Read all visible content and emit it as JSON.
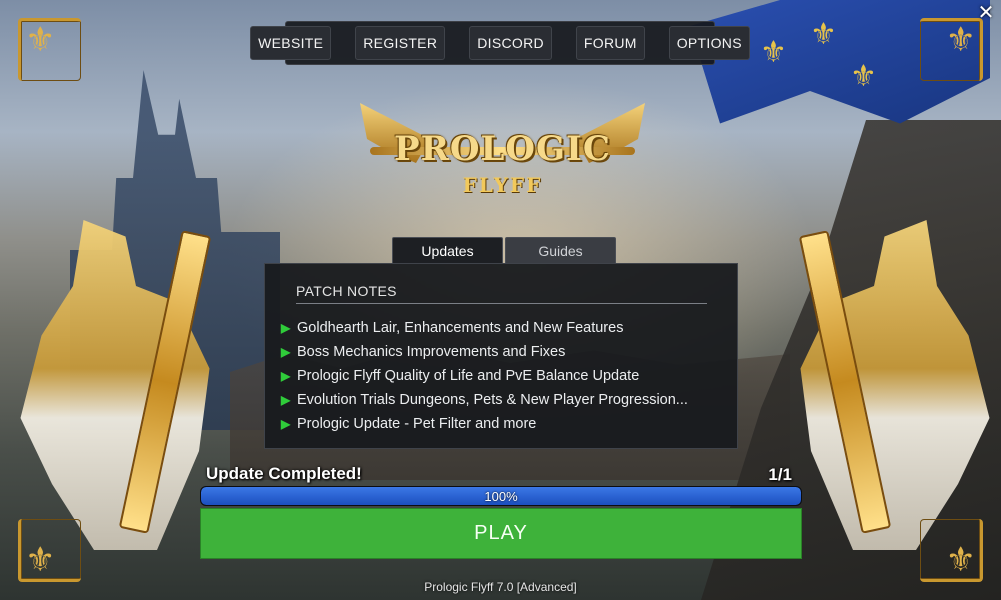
{
  "window": {
    "close_glyph": "✕"
  },
  "nav": {
    "items": [
      {
        "label": "WEBSITE"
      },
      {
        "label": "REGISTER"
      },
      {
        "label": "DISCORD"
      },
      {
        "label": "FORUM"
      },
      {
        "label": "OPTIONS"
      }
    ]
  },
  "logo": {
    "name": "PROLOGIC",
    "sub": "FLYFF"
  },
  "tabs": [
    {
      "label": "Updates",
      "active": true
    },
    {
      "label": "Guides",
      "active": false
    }
  ],
  "patch_notes": {
    "title": "PATCH NOTES",
    "arrow_glyph": "▶",
    "items": [
      "Goldhearth Lair, Enhancements and New Features",
      "Boss Mechanics Improvements and Fixes",
      "Prologic Flyff Quality of Life and PvE Balance Update",
      "Evolution Trials Dungeons, Pets & New Player Progression...",
      "Prologic Update - Pet Filter and more"
    ]
  },
  "status": {
    "text": "Update Completed!",
    "count": "1/1",
    "progress_label": "100%",
    "progress_fraction": 1.0
  },
  "play": {
    "label": "PLAY"
  },
  "footer": {
    "version": "Prologic Flyff 7.0 [Advanced]"
  },
  "colors": {
    "play_green": "#3eb23a",
    "progress_blue": "#2b63d8",
    "arrow_green": "#2fcc3a",
    "ornament_gold": "#c9982f",
    "flag_blue": "#2a4fb0"
  },
  "icons": {
    "close": "close-icon",
    "bullet": "chevron-right-icon",
    "fleur": "fleur-de-lis-icon"
  }
}
